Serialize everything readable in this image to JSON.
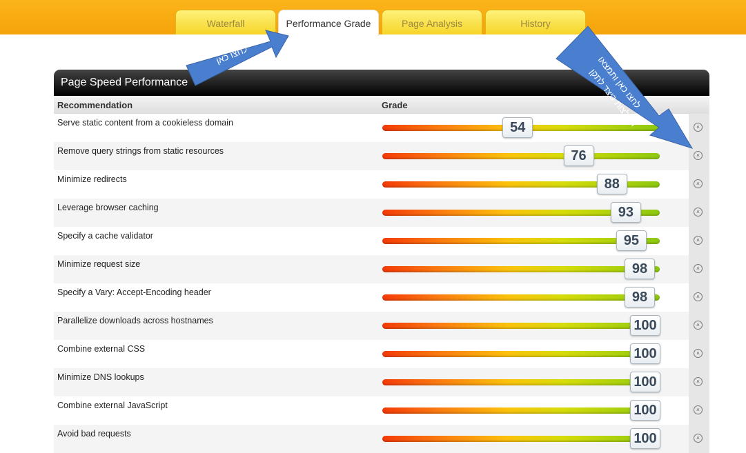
{
  "tabs": [
    {
      "label": "Waterfall",
      "active": false
    },
    {
      "label": "Performance Grade",
      "active": true
    },
    {
      "label": "Page Analysis",
      "active": false
    },
    {
      "label": "History",
      "active": false
    }
  ],
  "panel": {
    "title": "Page Speed Performance",
    "col_recommendation": "Recommendation",
    "col_grade": "Grade"
  },
  "rows": [
    {
      "name": "Serve static content from a cookieless domain",
      "grade": 54
    },
    {
      "name": "Remove query strings from static resources",
      "grade": 76
    },
    {
      "name": "Minimize redirects",
      "grade": 88
    },
    {
      "name": "Leverage browser caching",
      "grade": 93
    },
    {
      "name": "Specify a cache validator",
      "grade": 95
    },
    {
      "name": "Minimize request size",
      "grade": 98
    },
    {
      "name": "Specify a Vary: Accept-Encoding header",
      "grade": 98
    },
    {
      "name": "Parallelize downloads across hostnames",
      "grade": 100
    },
    {
      "name": "Combine external CSS",
      "grade": 100
    },
    {
      "name": "Minimize DNS lookups",
      "grade": 100
    },
    {
      "name": "Combine external JavaScript",
      "grade": 100
    },
    {
      "name": "Avoid bad requests",
      "grade": 100
    }
  ],
  "annotations": {
    "arrow1_text": "לחצו כאן",
    "arrow2_line1": "לחצו כאן ותמצאו",
    "arrow2_line2": "המלצות כיצד לתקן"
  },
  "colors": {
    "topbar": "#f5a30a",
    "arrow": "#4a7fd0",
    "bar_low": "#f43a08",
    "bar_high": "#8cc80e"
  }
}
